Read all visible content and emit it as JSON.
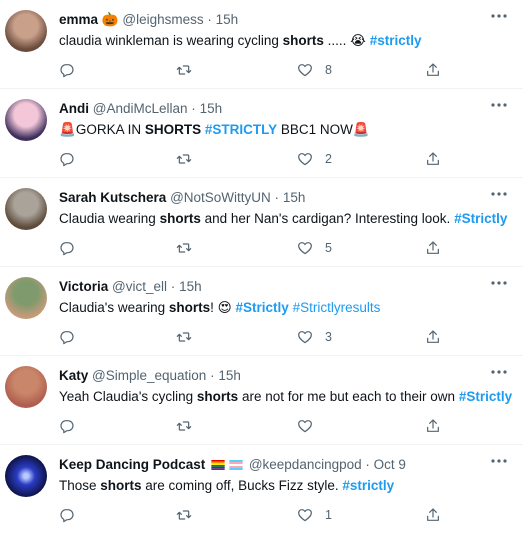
{
  "tweets": [
    {
      "name": "emma",
      "name_emoji": "🎃",
      "handle": "@leighsmess",
      "dot": "·",
      "time": "15h",
      "text_parts": [
        {
          "t": "claudia winkleman is wearing cycling ",
          "s": ""
        },
        {
          "t": "shorts",
          "s": "hl"
        },
        {
          "t": " ..... ",
          "s": ""
        },
        {
          "t": "😭",
          "s": ""
        },
        {
          "t": " ",
          "s": ""
        },
        {
          "t": "#strictly",
          "s": "tagb"
        }
      ],
      "likes": "8",
      "avatar_colors": [
        "#c9a08a",
        "#6a4a3c"
      ]
    },
    {
      "name": "Andi",
      "handle": "@AndiMcLellan",
      "dot": "·",
      "time": "15h",
      "text_parts": [
        {
          "t": "🚨",
          "s": ""
        },
        {
          "t": "GORKA IN ",
          "s": ""
        },
        {
          "t": "SHORTS",
          "s": "hl"
        },
        {
          "t": " ",
          "s": ""
        },
        {
          "t": "#STRICTLY",
          "s": "tagb"
        },
        {
          "t": " BBC1 NOW",
          "s": ""
        },
        {
          "t": "🚨",
          "s": ""
        }
      ],
      "likes": "2",
      "avatar_colors": [
        "#f3c7d8",
        "#3d2f5c"
      ]
    },
    {
      "name": "Sarah Kutschera",
      "handle": "@NotSoWittyUN",
      "dot": "·",
      "time": "15h",
      "text_parts": [
        {
          "t": "Claudia wearing ",
          "s": ""
        },
        {
          "t": "shorts",
          "s": "hl"
        },
        {
          "t": " and her Nan's cardigan? Interesting look. ",
          "s": ""
        },
        {
          "t": "#Strictly",
          "s": "tagb"
        }
      ],
      "likes": "5",
      "avatar_colors": [
        "#a9a39a",
        "#5e4b3b"
      ]
    },
    {
      "name": "Victoria",
      "handle": "@vict_ell",
      "dot": "·",
      "time": "15h",
      "text_parts": [
        {
          "t": "Claudia's wearing ",
          "s": ""
        },
        {
          "t": "shorts",
          "s": "hl"
        },
        {
          "t": "! ",
          "s": ""
        },
        {
          "t": "😍",
          "s": ""
        },
        {
          "t": " ",
          "s": ""
        },
        {
          "t": "#Strictly",
          "s": "tagb"
        },
        {
          "t": " ",
          "s": ""
        },
        {
          "t": "#Strictlyresults",
          "s": "tag"
        }
      ],
      "likes": "3",
      "avatar_colors": [
        "#7f9a6d",
        "#c49a7a"
      ]
    },
    {
      "name": "Katy",
      "handle": "@Simple_equation",
      "dot": "·",
      "time": "15h",
      "text_parts": [
        {
          "t": "Yeah Claudia's cycling ",
          "s": ""
        },
        {
          "t": "shorts",
          "s": "hl"
        },
        {
          "t": " are not for me but each to their own ",
          "s": ""
        },
        {
          "t": "#Strictly",
          "s": "tagb"
        }
      ],
      "likes": "",
      "avatar_colors": [
        "#c9866a",
        "#b05f4e"
      ]
    },
    {
      "name": "Keep Dancing Podcast",
      "handle": "@keepdancingpod",
      "dot": "·",
      "time": "Oct 9",
      "text_parts": [
        {
          "t": "Those ",
          "s": ""
        },
        {
          "t": "shorts",
          "s": "hl"
        },
        {
          "t": " are coming off, Bucks Fizz style. ",
          "s": ""
        },
        {
          "t": "#strictly",
          "s": "tagb"
        }
      ],
      "likes": "1",
      "avatar_colors": [
        "#2a3cc4",
        "#0a0f3a"
      ]
    }
  ],
  "icons": {
    "reply": "reply-icon",
    "retweet": "retweet-icon",
    "like": "heart-icon",
    "share": "share-icon",
    "more": "more-icon"
  },
  "colors": {
    "accent": "#1d9bf0",
    "muted": "#536471",
    "text": "#0f1419",
    "divider": "#eff3f4"
  }
}
